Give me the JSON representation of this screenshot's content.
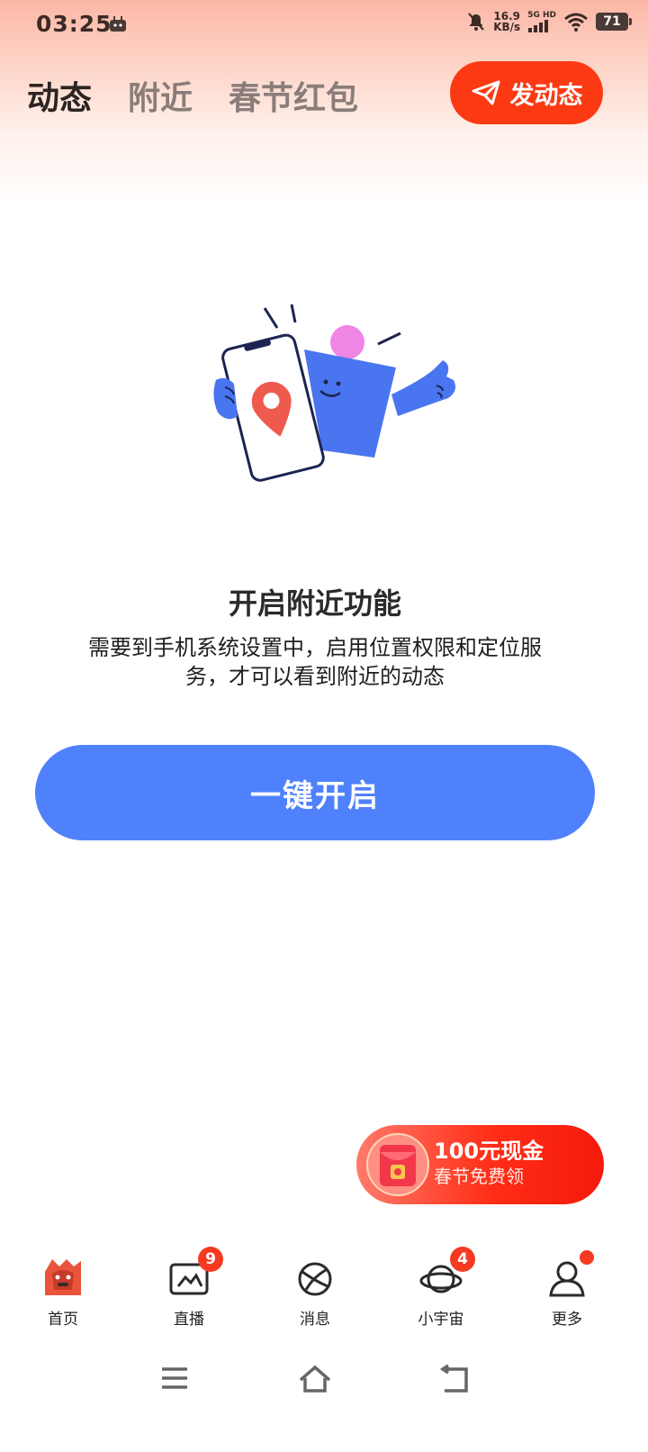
{
  "status_bar": {
    "time": "03:25",
    "net_speed_value": "16.9",
    "net_speed_unit": "KB/s",
    "signal_label": "5G HD",
    "battery": "71"
  },
  "tabs": [
    {
      "label": "动态",
      "active": true
    },
    {
      "label": "附近",
      "active": false
    },
    {
      "label": "春节红包",
      "active": false
    }
  ],
  "post_button": {
    "label": "发动态",
    "icon": "send-icon"
  },
  "nearby_prompt": {
    "title": "开启附近功能",
    "description": "需要到手机系统设置中，启用位置权限和定位服务，才可以看到附近的动态",
    "button_label": "一键开启",
    "illustration": "location-illustration"
  },
  "promo": {
    "main": "100元现金",
    "sub": "春节免费领",
    "icon": "red-envelope-icon"
  },
  "bottom_nav": [
    {
      "label": "首页",
      "icon": "home-horse-icon",
      "badge": null,
      "dot": false
    },
    {
      "label": "直播",
      "icon": "live-tv-icon",
      "badge": "9",
      "dot": false
    },
    {
      "label": "消息",
      "icon": "message-planet-icon",
      "badge": null,
      "dot": false
    },
    {
      "label": "小宇宙",
      "icon": "universe-icon",
      "badge": "4",
      "dot": false
    },
    {
      "label": "更多",
      "icon": "more-person-icon",
      "badge": null,
      "dot": true
    }
  ],
  "colors": {
    "accent_red": "#fb3a14",
    "primary_blue": "#4f81fc",
    "badge_red": "#f53a21"
  }
}
